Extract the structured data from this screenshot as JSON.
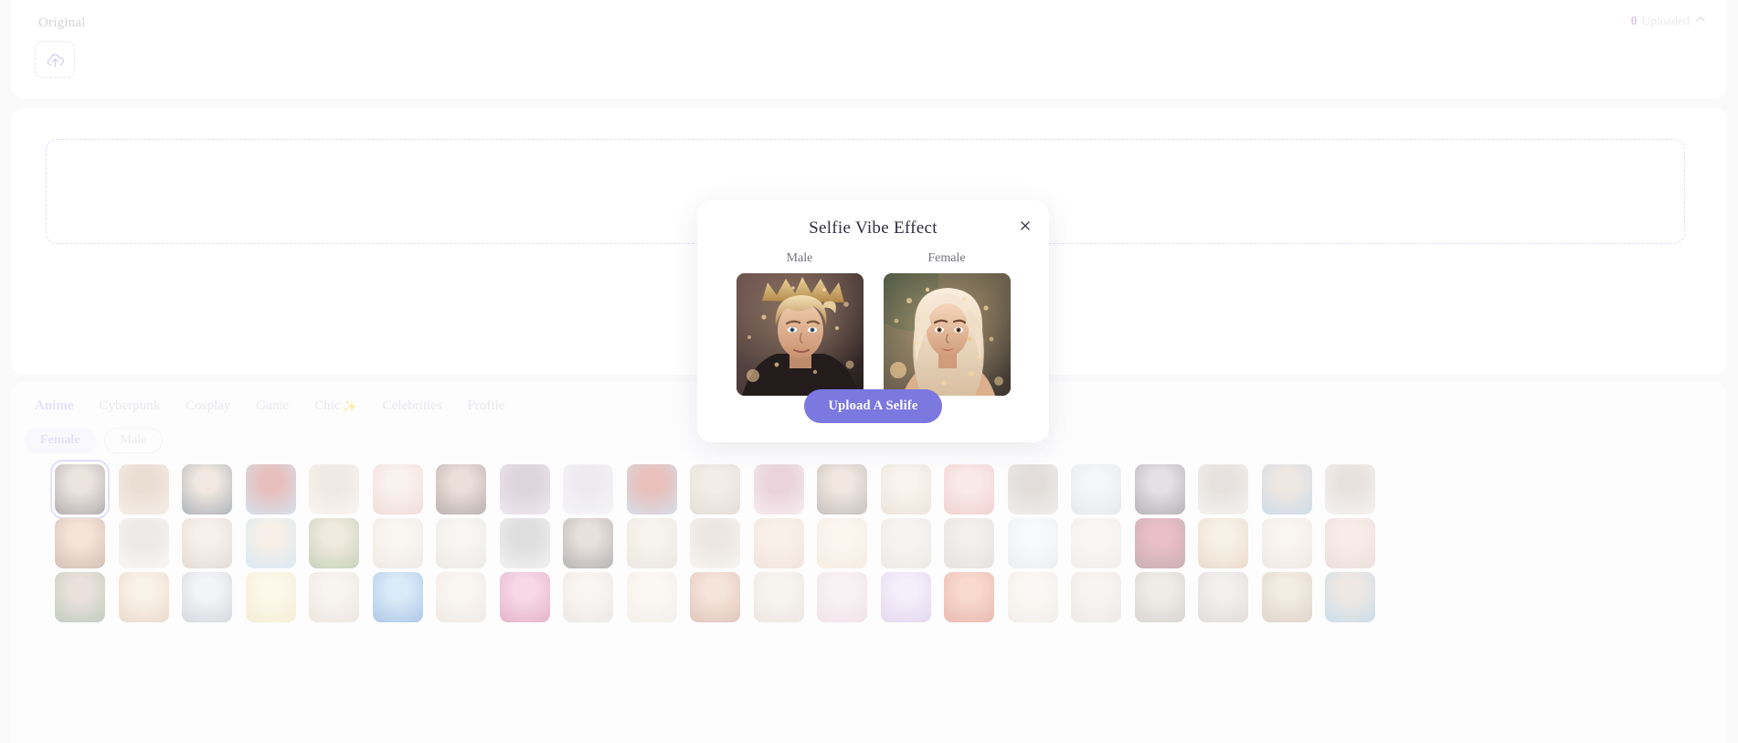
{
  "upload_panel": {
    "label": "Original",
    "dropzone_icon": "cloud-upload-icon",
    "uploaded_count": "0",
    "uploaded_label": "Uploaded",
    "collapse_icon": "chevron-up-icon"
  },
  "workspace": {
    "dropzone_placeholder": ""
  },
  "gallery": {
    "tabs": [
      {
        "label": "Anime",
        "active": true
      },
      {
        "label": "Cyberpunk",
        "active": false
      },
      {
        "label": "Cosplay",
        "active": false
      },
      {
        "label": "Game",
        "active": false
      },
      {
        "label": "Chic",
        "sparkle": "✨",
        "active": false
      },
      {
        "label": "Celebrities",
        "active": false
      },
      {
        "label": "Profile",
        "active": false
      }
    ],
    "gender_pills": [
      {
        "label": "Female",
        "active": true
      },
      {
        "label": "Male",
        "active": false
      }
    ],
    "rows": 3,
    "columns": 21,
    "selected_index": 0,
    "thumbnails": [
      {
        "c1": "#3a2e30",
        "c2": "#cfb8ae"
      },
      {
        "c1": "#e5d3c4",
        "c2": "#c8a88d"
      },
      {
        "c1": "#2e3a4a",
        "c2": "#d8c3b0"
      },
      {
        "c1": "#8fb4cf",
        "c2": "#c05a55"
      },
      {
        "c1": "#efe6dd",
        "c2": "#d6c5b6"
      },
      {
        "c1": "#d7a5a0",
        "c2": "#f0dcd2"
      },
      {
        "c1": "#4a3436",
        "c2": "#caa79a"
      },
      {
        "c1": "#cfc4d6",
        "c2": "#a98ea0"
      },
      {
        "c1": "#e7e4ea",
        "c2": "#cfcad6"
      },
      {
        "c1": "#8fa9c4",
        "c2": "#c65a4f"
      },
      {
        "c1": "#b8a99c",
        "c2": "#e0cfc0"
      },
      {
        "c1": "#e9cfd6",
        "c2": "#c78ba0"
      },
      {
        "c1": "#6b5a52",
        "c2": "#d9bfae"
      },
      {
        "c1": "#cbb9a2",
        "c2": "#efe1cf"
      },
      {
        "c1": "#d98a8a",
        "c2": "#f2c7c0"
      },
      {
        "c1": "#d7d2cc",
        "c2": "#b2a79e"
      },
      {
        "c1": "#bfc6cf",
        "c2": "#e3e6ea"
      },
      {
        "c1": "#3b3a42",
        "c2": "#b9aeb6"
      },
      {
        "c1": "#e2dcd6",
        "c2": "#bfb3aa"
      },
      {
        "c1": "#7fa0be",
        "c2": "#d2c2b4"
      },
      {
        "c1": "#e5ddd7",
        "c2": "#c2b4ab"
      },
      {
        "c1": "#8c5a3f",
        "c2": "#e3b996"
      },
      {
        "c1": "#efe9e4",
        "c2": "#cfc4bd"
      },
      {
        "c1": "#b9a193",
        "c2": "#e8d9cd"
      },
      {
        "c1": "#9ec4de",
        "c2": "#e7d7c3"
      },
      {
        "c1": "#6f8a4e",
        "c2": "#d5c8a8"
      },
      {
        "c1": "#d3c7bd",
        "c2": "#f0e6dd"
      },
      {
        "c1": "#cfc9c2",
        "c2": "#ece6df"
      },
      {
        "c1": "#dcdcdc",
        "c2": "#a8a8a8"
      },
      {
        "c1": "#3e3a3c",
        "c2": "#c3ada4"
      },
      {
        "c1": "#c9bfae",
        "c2": "#e9dfd0"
      },
      {
        "c1": "#e8e3dc",
        "c2": "#cdbfb2"
      },
      {
        "c1": "#d9b7a6",
        "c2": "#f0d8c8"
      },
      {
        "c1": "#e7cdb4",
        "c2": "#f6e7d6"
      },
      {
        "c1": "#cfc6bd",
        "c2": "#e8e2da"
      },
      {
        "c1": "#bcb3ab",
        "c2": "#dcd4cc"
      },
      {
        "c1": "#cdd6dc",
        "c2": "#eceff1"
      },
      {
        "c1": "#d9d3cd",
        "c2": "#efeae5"
      },
      {
        "c1": "#6b2f3a",
        "c2": "#c8576a"
      },
      {
        "c1": "#c8a27a",
        "c2": "#ecd9bf"
      },
      {
        "c1": "#d6c5b8",
        "c2": "#efe4da"
      },
      {
        "c1": "#cfa9a0",
        "c2": "#eccec5"
      },
      {
        "c1": "#5f7a5e",
        "c2": "#c7b0a0"
      },
      {
        "c1": "#c9a277",
        "c2": "#efdcc4"
      },
      {
        "c1": "#8f99a6",
        "c2": "#dfe3e8"
      },
      {
        "c1": "#e4d08f",
        "c2": "#f6ecc9"
      },
      {
        "c1": "#cdbfae",
        "c2": "#ece2d6"
      },
      {
        "c1": "#2f6fbf",
        "c2": "#9cc8ec"
      },
      {
        "c1": "#d6c7ba",
        "c2": "#f0e7dd"
      },
      {
        "c1": "#b83a6e",
        "c2": "#ec9ac0"
      },
      {
        "c1": "#cfc4bb",
        "c2": "#ece5de"
      },
      {
        "c1": "#dfd5c9",
        "c2": "#f3ece3"
      },
      {
        "c1": "#b06a52",
        "c2": "#e5b79c"
      },
      {
        "c1": "#cdbfb4",
        "c2": "#eae1d8"
      },
      {
        "c1": "#d8b6c3",
        "c2": "#f2dbe4"
      },
      {
        "c1": "#b59ad8",
        "c2": "#e3d4f2"
      },
      {
        "c1": "#c4492f",
        "c2": "#ef9a7e"
      },
      {
        "c1": "#dcd2c8",
        "c2": "#f2ebe3"
      },
      {
        "c1": "#cfc7bf",
        "c2": "#e9e3dc"
      },
      {
        "c1": "#9a8f86",
        "c2": "#d6ccc3"
      },
      {
        "c1": "#b0a79e",
        "c2": "#dcd5ce"
      },
      {
        "c1": "#a88e74",
        "c2": "#e0cdb5"
      },
      {
        "c1": "#76a6c9",
        "c2": "#d5c3b4"
      }
    ]
  },
  "modal": {
    "title": "Selfie Vibe Effect",
    "close_icon": "close-icon",
    "options": [
      {
        "label": "Male",
        "image_alt": "male-portrait-crown-sparkles"
      },
      {
        "label": "Female",
        "image_alt": "female-portrait-blonde-sparkles"
      }
    ],
    "cta_label": "Upload A Selife",
    "cta_color": "#7b78e0"
  }
}
